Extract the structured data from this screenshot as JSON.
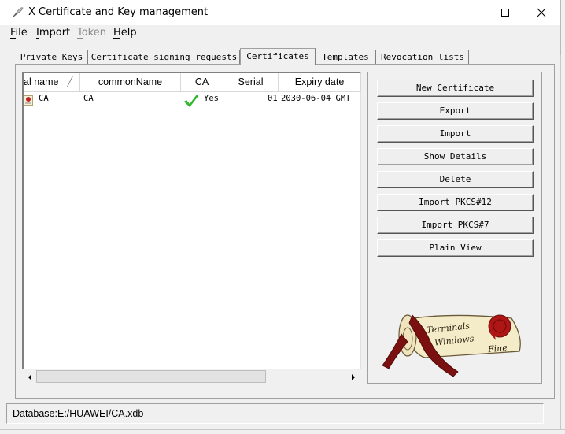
{
  "window": {
    "title": "X Certificate and Key management",
    "minimize_icon": "minimize-icon",
    "maximize_icon": "maximize-icon",
    "close_icon": "close-icon",
    "app_icon": "quill-pen-icon"
  },
  "menu": {
    "items": [
      {
        "label": "File",
        "enabled": true
      },
      {
        "label": "Import",
        "enabled": true
      },
      {
        "label": "Token",
        "enabled": false
      },
      {
        "label": "Help",
        "enabled": true
      }
    ]
  },
  "tabs": [
    {
      "label": "Private Keys",
      "active": false
    },
    {
      "label": "Certificate signing requests",
      "active": false
    },
    {
      "label": "Certificates",
      "active": true
    },
    {
      "label": "Templates",
      "active": false
    },
    {
      "label": "Revocation lists",
      "active": false
    }
  ],
  "table": {
    "columns": [
      "al name",
      "commonName",
      "CA",
      "Serial",
      "Expiry date"
    ],
    "rows": [
      {
        "name": "CA",
        "commonName": "CA",
        "ca_check": true,
        "ca": "Yes",
        "serial": "01",
        "expiry": "2030-06-04 GMT"
      }
    ]
  },
  "buttons": {
    "new_certificate": "New Certificate",
    "export": "Export",
    "import": "Import",
    "show_details": "Show Details",
    "delete": "Delete",
    "import_pkcs12": "Import PKCS#12",
    "import_pkcs7": "Import PKCS#7",
    "plain_view": "Plain View"
  },
  "logo": {
    "line1": "Terminals",
    "line2": "Windows",
    "line3": "Fine"
  },
  "status": {
    "text": "Database:E:/HUAWEI/CA.xdb"
  },
  "colors": {
    "check": "#2db82d",
    "seal": "#b01515",
    "scroll_paper": "#f4ecc8"
  }
}
